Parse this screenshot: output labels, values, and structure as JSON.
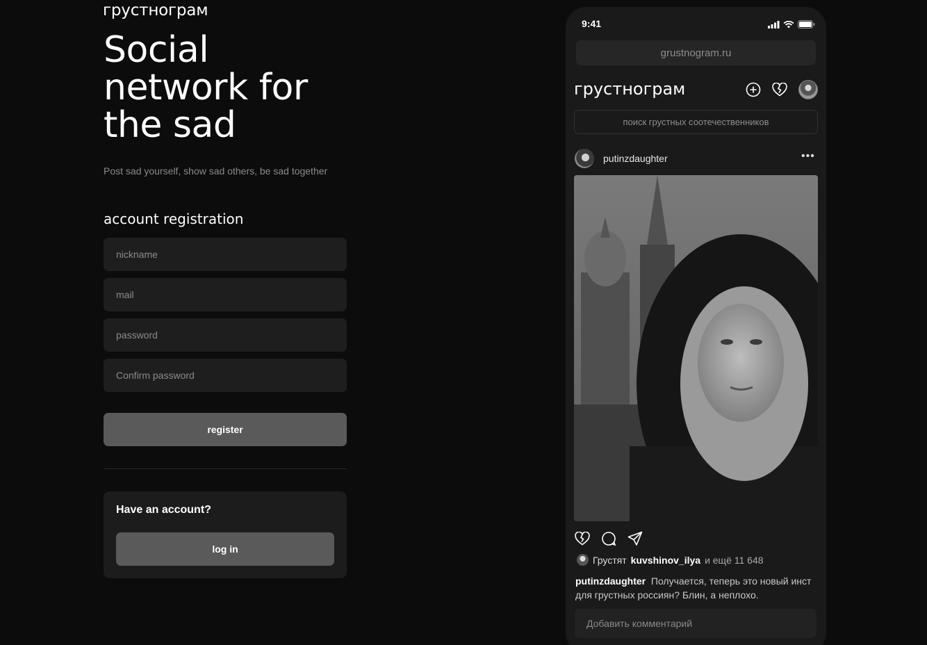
{
  "brand": "грустнограм",
  "hero": {
    "line1": "Social",
    "line2": "network for",
    "line3": "the sad"
  },
  "tagline": "Post sad yourself, show sad others, be sad together",
  "registration": {
    "title": "account registration",
    "nickname_placeholder": "nickname",
    "mail_placeholder": "mail",
    "password_placeholder": "password",
    "confirm_placeholder": "Confirm password",
    "register_label": "register"
  },
  "login": {
    "question": "Have an account?",
    "button_label": "log in"
  },
  "phone": {
    "time": "9:41",
    "url": "grustnogram.ru",
    "app_title": "грустнограм",
    "search_placeholder": "поиск грустных соотечественников",
    "post": {
      "username": "putinzdaughter",
      "likes_prefix": "Грустят",
      "likes_user": "kuvshinov_ilya",
      "likes_rest": "и ещё 11 648",
      "caption_user": "putinzdaughter",
      "caption_text": "Получается, теперь это новый инст для грустных россиян? Блин, а неплохо.",
      "comment_placeholder": "Добавить комментарий"
    }
  },
  "icons": {
    "add": "plus-circle-icon",
    "broken_heart": "broken-heart-icon",
    "comment": "comment-bubble-icon",
    "share": "paper-plane-icon",
    "more": "more-dots-icon",
    "signal": "cellular-signal-icon",
    "wifi": "wifi-icon",
    "battery": "battery-icon"
  },
  "colors": {
    "background": "#0c0c0c",
    "phone_bg": "#1a1a1a",
    "field_bg": "#1e1e1e",
    "button_bg": "#5a5a5a"
  }
}
